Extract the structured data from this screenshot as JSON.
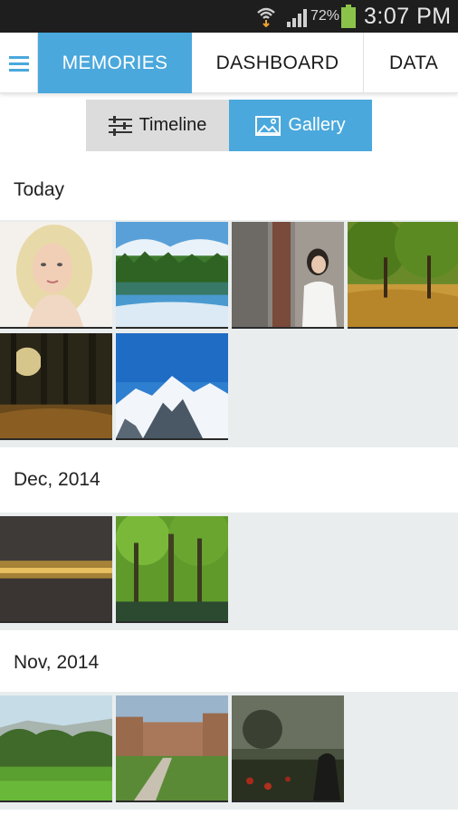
{
  "status_bar": {
    "battery_percent": "72%",
    "time": "3:07 PM",
    "icons": [
      "wifi-icon",
      "signal-icon",
      "battery-icon"
    ],
    "battery_color": "#8bc34a"
  },
  "tabs": {
    "menu_icon": "hamburger-menu-icon",
    "memories": "MEMORIES",
    "dashboard": "DASHBOARD",
    "data": "DATA",
    "active": "MEMORIES",
    "accent_color": "#4aa8dc"
  },
  "view_toggle": {
    "timeline": "Timeline",
    "gallery": "Gallery",
    "timeline_icon": "sliders-icon",
    "gallery_icon": "image-icon",
    "active": "Gallery"
  },
  "sections": [
    {
      "label": "Today",
      "photos": [
        "blonde woman portrait",
        "lake reflection landscape",
        "woman on porch",
        "autumn trees park",
        "sunlit forest",
        "snowy mountains"
      ]
    },
    {
      "label": "Dec, 2014",
      "photos": [
        "sunset horizon",
        "green forest river"
      ]
    },
    {
      "label": "Nov, 2014",
      "photos": [
        "meadow and hills",
        "old fortress wall",
        "dark field with figure"
      ]
    }
  ]
}
